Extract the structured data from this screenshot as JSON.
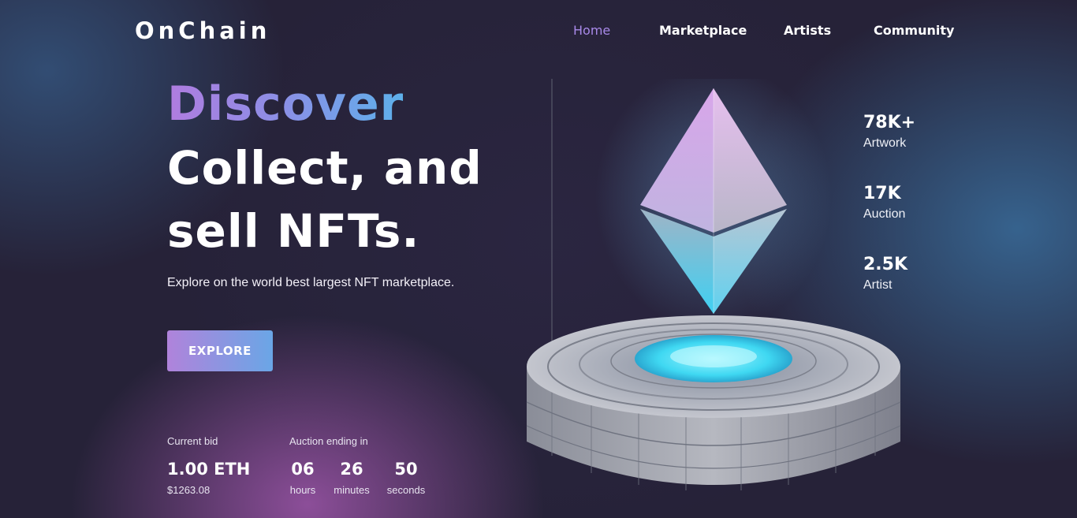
{
  "brand": {
    "logo": "OnChain"
  },
  "nav": {
    "items": [
      {
        "label": "Home",
        "active": true
      },
      {
        "label": "Marketplace",
        "active": false
      },
      {
        "label": "Artists",
        "active": false
      },
      {
        "label": "Community",
        "active": false
      }
    ]
  },
  "hero": {
    "line1": "Discover",
    "line2": "Collect, and",
    "line3": "sell NFTs.",
    "subtitle": "Explore on the world best largest NFT marketplace.",
    "cta_label": "EXPLORE"
  },
  "bid": {
    "label": "Current bid",
    "value": "1.00 ETH",
    "usd": "$1263.08"
  },
  "auction": {
    "label": "Auction ending in",
    "hours": "06",
    "hours_label": "hours",
    "minutes": "26",
    "minutes_label": "minutes",
    "seconds": "50",
    "seconds_label": "seconds"
  },
  "stats": [
    {
      "value": "78K+",
      "label": "Artwork"
    },
    {
      "value": "17K",
      "label": "Auction"
    },
    {
      "value": "2.5K",
      "label": "Artist"
    }
  ],
  "colors": {
    "accent_purple": "#a889e8",
    "accent_blue": "#5db0ea",
    "background": "#262238",
    "glow_cyan": "#3fd8f2"
  },
  "icons": {
    "hero_art": "ethereum-diamond-on-pedestal-illustration"
  }
}
